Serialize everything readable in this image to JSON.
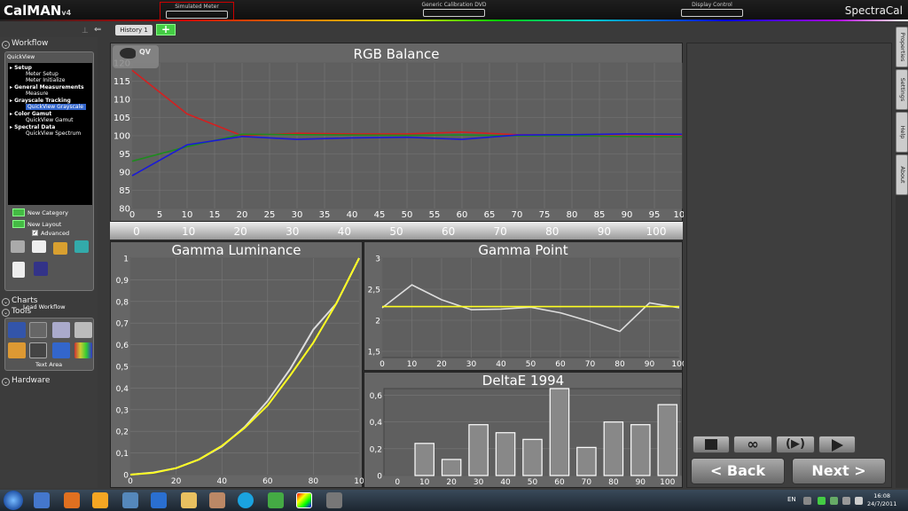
{
  "app": {
    "logo": "CalMAN",
    "logo_version": "v4",
    "brand": "SpectraCal",
    "meter_label": "Simulated Meter",
    "source_label": "Generic Calibration DVD",
    "display_label": "Display Control"
  },
  "history": {
    "tab_label": "History 1",
    "add_label": "+"
  },
  "sidebar": {
    "workflow_title": "Workflow",
    "quickview_label": "QuickView",
    "tree": [
      {
        "category": "Setup",
        "items": [
          "Meter Setup",
          "Meter Initialize"
        ]
      },
      {
        "category": "General Measurements",
        "items": [
          "Measure"
        ]
      },
      {
        "category": "Grayscale Tracking",
        "items": [
          "QuickView Grayscale"
        ]
      },
      {
        "category": "Color Gamut",
        "items": [
          "QuickView Gamut"
        ]
      },
      {
        "category": "Spectral Data",
        "items": [
          "QuickView Spectrum"
        ]
      }
    ],
    "selected_item": "QuickView Grayscale",
    "new_category": "New Category",
    "new_layout": "New Layout",
    "advanced": "Advanced",
    "advanced_checked": true,
    "load_workflow": "Load Workflow",
    "charts_title": "Charts",
    "tools_title": "Tools",
    "text_area": "Text Area",
    "hardware_title": "Hardware"
  },
  "qv_badge": "QV",
  "rgb_x_labels": [
    "0",
    "10",
    "20",
    "30",
    "40",
    "50",
    "60",
    "70",
    "80",
    "90",
    "100"
  ],
  "right_tabs": [
    "Properties",
    "Settings",
    "Help",
    "About"
  ],
  "controls": {
    "stop_icon": "stop-icon",
    "loop_icon": "infinity-icon",
    "play_continuous_icon": "play-paren-icon",
    "play_icon": "play-icon",
    "loop_label": "∞",
    "play_continuous_label": "(▶)",
    "back_label": "< Back",
    "next_label": "Next >"
  },
  "taskbar": {
    "language": "EN",
    "time": "16:08",
    "date": "24/7/2011"
  },
  "colors": {
    "red": "#d42020",
    "green": "#1f8a1f",
    "blue": "#1a1ad8",
    "yellow": "#ffff22",
    "white_line": "#dddddd"
  },
  "chart_data": [
    {
      "type": "line",
      "title": "RGB Balance",
      "xlim": [
        0,
        100
      ],
      "ylim": [
        80,
        120
      ],
      "x_ticks": [
        0,
        5,
        10,
        15,
        20,
        25,
        30,
        35,
        40,
        45,
        50,
        55,
        60,
        65,
        70,
        75,
        80,
        85,
        90,
        95,
        100
      ],
      "y_ticks": [
        80,
        85,
        90,
        95,
        100,
        105,
        110,
        115,
        120
      ],
      "grid": true,
      "x": [
        0,
        10,
        20,
        30,
        40,
        50,
        60,
        70,
        80,
        90,
        100
      ],
      "series": [
        {
          "color": "red",
          "values": [
            118,
            106,
            100,
            100.7,
            100.5,
            100.5,
            101,
            100.3,
            100.2,
            100.3,
            100.2
          ]
        },
        {
          "color": "green",
          "values": [
            93,
            97,
            100.4,
            100.3,
            100.2,
            100.1,
            100.2,
            100,
            100,
            99.8,
            99.7
          ]
        },
        {
          "color": "blue",
          "values": [
            89,
            97.5,
            99.8,
            99,
            99.4,
            99.6,
            99,
            100.2,
            100.3,
            100.5,
            100.4
          ]
        }
      ]
    },
    {
      "type": "line",
      "title": "Gamma Luminance",
      "xlim": [
        0,
        100
      ],
      "ylim": [
        0,
        1
      ],
      "x_ticks": [
        "0",
        "20",
        "40",
        "60",
        "80",
        "10"
      ],
      "y_ticks": [
        "0",
        "0,1",
        "0,2",
        "0,3",
        "0,4",
        "0,5",
        "0,6",
        "0,7",
        "0,8",
        "0,9",
        "1"
      ],
      "grid": true,
      "x": [
        0,
        10,
        20,
        30,
        40,
        50,
        60,
        70,
        80,
        90,
        100
      ],
      "series": [
        {
          "color": "white_line",
          "values": [
            0,
            0.01,
            0.03,
            0.07,
            0.13,
            0.22,
            0.34,
            0.49,
            0.67,
            0.79,
            1.0
          ]
        },
        {
          "color": "yellow",
          "values": [
            0,
            0.008,
            0.03,
            0.07,
            0.133,
            0.216,
            0.32,
            0.46,
            0.61,
            0.79,
            1.0
          ]
        }
      ]
    },
    {
      "type": "line",
      "title": "Gamma Point",
      "xlim": [
        0,
        100
      ],
      "ylim": [
        1.4,
        3
      ],
      "x_ticks": [
        0,
        10,
        20,
        30,
        40,
        50,
        60,
        70,
        80,
        90,
        100
      ],
      "y_ticks": [
        "1,5",
        "2",
        "2,5",
        "3"
      ],
      "grid": true,
      "x": [
        0,
        10,
        20,
        30,
        40,
        50,
        60,
        70,
        80,
        90,
        100
      ],
      "series": [
        {
          "color": "white_line",
          "values": [
            2.2,
            2.57,
            2.33,
            2.17,
            2.18,
            2.21,
            2.12,
            1.98,
            1.82,
            2.28,
            2.2
          ]
        },
        {
          "color": "yellow",
          "values": [
            2.22,
            2.22,
            2.22,
            2.22,
            2.22,
            2.22,
            2.22,
            2.22,
            2.22,
            2.22,
            2.22
          ]
        }
      ]
    },
    {
      "type": "bar",
      "title": "DeltaE 1994",
      "categories": [
        "0",
        "10",
        "20",
        "30",
        "40",
        "50",
        "60",
        "70",
        "80",
        "90",
        "100"
      ],
      "values": [
        0,
        0.24,
        0.12,
        0.38,
        0.32,
        0.27,
        0.65,
        0.21,
        0.4,
        0.38,
        0.53
      ],
      "ylim": [
        0,
        0.65
      ],
      "y_ticks": [
        "0",
        "0,2",
        "0,4",
        "0,6"
      ],
      "grid": true
    }
  ]
}
